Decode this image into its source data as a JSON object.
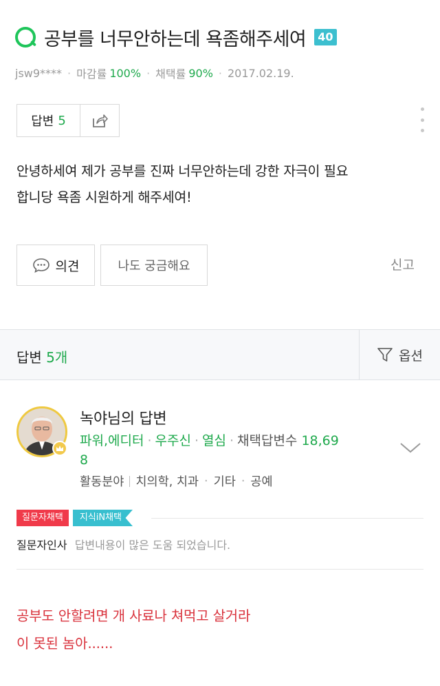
{
  "question": {
    "title": "공부를 너무안하는데 욕좀해주세여",
    "points": "40",
    "author": "jsw9****",
    "close_rate_label": "마감률",
    "close_rate": "100%",
    "adopt_rate_label": "채택률",
    "adopt_rate": "90%",
    "date": "2017.02.19.",
    "body_line1": "안녕하세여 제가 공부를 진짜 너무안하는데 강한 자극이 필요",
    "body_line2": "합니당 욕좀 시원하게 해주세여!"
  },
  "actions": {
    "answers_label": "답변",
    "answers_count": "5",
    "opinion_label": "의견",
    "curious_label": "나도 궁금해요",
    "report_label": "신고"
  },
  "answers_section": {
    "label": "답변",
    "count": "5개",
    "sort_label": "옵션"
  },
  "answer": {
    "name": "녹야님의 답변",
    "rank1": "파워,에디터",
    "rank2": "우주신",
    "rank3": "열심",
    "adopted_label": "채택답변수",
    "adopted_count_a": "18,69",
    "adopted_count_b": "8",
    "activity_label": "활동분야",
    "field1": "치의학, 치과",
    "field2": "기타",
    "field3": "공예",
    "badge_questioner": "질문자채택",
    "badge_jisik": "지식iN채택",
    "thanks_label": "질문자인사",
    "thanks_text": "답변내용이 많은 도움 되었습니다.",
    "body_line1": "공부도 안할려면 개 사료나 쳐먹고 살거라",
    "body_line2": "이 못된 놈아......"
  },
  "colors": {
    "green": "#1ea94c",
    "red_text": "#d9323c",
    "badge_red": "#f03a4a",
    "badge_teal": "#38bfcf"
  }
}
